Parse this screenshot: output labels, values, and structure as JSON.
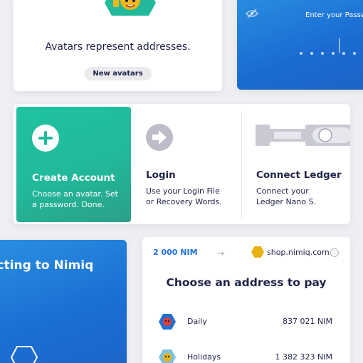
{
  "avatars_card": {
    "description": "Avatars represent addresses.",
    "button_label": "New avatars"
  },
  "password_card": {
    "label": "Enter your Passwo",
    "icon": "eye-off-icon"
  },
  "options": {
    "create": {
      "title": "Create Account",
      "desc_line1": "Choose an avatar. Set",
      "desc_line2": "a password. Done.",
      "icon": "plus-circle-icon"
    },
    "login": {
      "title": "Login",
      "desc_line1": "Use your Login File",
      "desc_line2": "or Recovery Words.",
      "icon": "arrow-right-circle-icon"
    },
    "ledger": {
      "title": "Connect Ledger",
      "desc_line1": "Connect your",
      "desc_line2": "Ledger Nano S.",
      "icon": "ledger-device-icon"
    }
  },
  "connecting_card": {
    "text": "ecting to Nimiq"
  },
  "pay_card": {
    "amount": "2 000 NIM",
    "arrow": "→",
    "shop": "shop.nimiq.com",
    "info": "i",
    "title": "Choose an address to pay",
    "addresses": [
      {
        "name": "Daily",
        "balance": "837 021 NIM"
      },
      {
        "name": "Holidays",
        "balance": "1 382 323 NIM"
      }
    ]
  },
  "colors": {
    "background": "#eeeff2",
    "text_dark": "#1f2348",
    "green": "#21b99a",
    "blue": "#1f6fd4",
    "gold": "#e9b213"
  }
}
